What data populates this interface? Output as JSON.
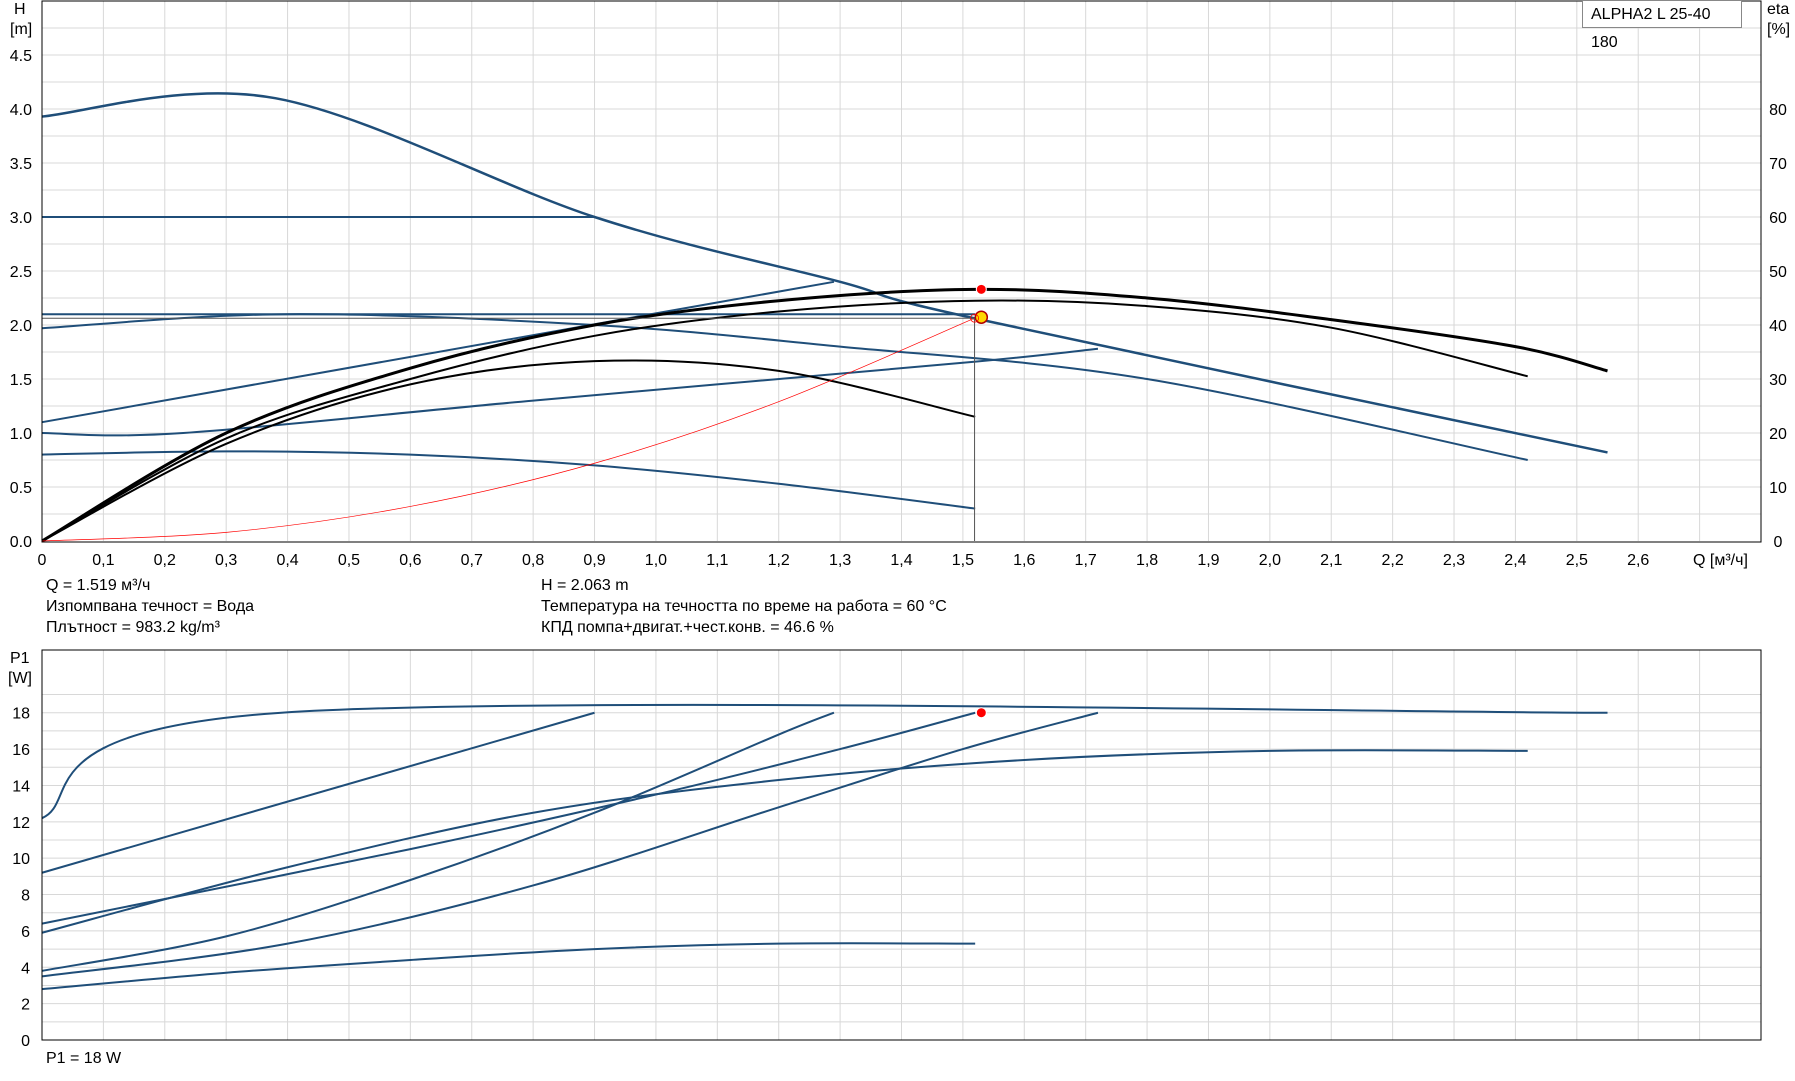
{
  "top_chart": {
    "y_left_label_line1": "H",
    "y_left_label_line2": "[m]",
    "y_right_label_line1": "eta",
    "y_right_label_line2": "[%]",
    "x_label": "Q [м³/ч]",
    "x_ticks": [
      "0",
      "0,1",
      "0,2",
      "0,3",
      "0,4",
      "0,5",
      "0,6",
      "0,7",
      "0,8",
      "0,9",
      "1,0",
      "1,1",
      "1,2",
      "1,3",
      "1,4",
      "1,5",
      "1,6",
      "1,7",
      "1,8",
      "1,9",
      "2,0",
      "2,1",
      "2,2",
      "2,3",
      "2,4",
      "2,5",
      "2,6"
    ],
    "y_left_ticks": [
      "0.0",
      "0.5",
      "1.0",
      "1.5",
      "2.0",
      "2.5",
      "3.0",
      "3.5",
      "4.0",
      "4.5"
    ],
    "y_right_ticks": [
      "0",
      "10",
      "20",
      "30",
      "40",
      "50",
      "60",
      "70",
      "80"
    ],
    "model_label": "ALPHA2 L 25-40 180"
  },
  "info": {
    "q": "Q = 1.519 м³/ч",
    "fluid": "Изпомпвана течност = Вода",
    "density": "Плътност = 983.2 kg/m³",
    "h": "H = 2.063 m",
    "temp": "Температура на течността по време на работа = 60 °C",
    "eff": "КПД помпа+двигат.+чест.конв. = 46.6 %",
    "p1": "P1 = 18 W"
  },
  "bottom_chart": {
    "y_label_line1": "P1",
    "y_label_line2": "[W]",
    "y_ticks": [
      "0",
      "2",
      "4",
      "6",
      "8",
      "10",
      "12",
      "14",
      "16",
      "18"
    ]
  },
  "colors": {
    "blue": "#1f4e79",
    "black": "#000000",
    "red": "#ff0000",
    "yellow": "#ffd700",
    "grid": "#d8d8d8"
  },
  "chart_data": [
    {
      "type": "line",
      "title": "",
      "xlabel": "Q [м³/ч]",
      "ylabel": "H [m]",
      "y2label": "eta [%]",
      "xlim": [
        0,
        2.8
      ],
      "ylim": [
        0,
        5.0
      ],
      "y2lim": [
        0,
        100
      ],
      "grid": true,
      "series": [
        {
          "axis": "H",
          "style": "blue",
          "x": [
            0,
            0.38,
            0.9,
            1.3,
            1.52,
            2.55
          ],
          "y": [
            3.93,
            4.1,
            3.0,
            2.4,
            2.06,
            0.82
          ]
        },
        {
          "axis": "H",
          "style": "blue",
          "x": [
            0,
            0.9
          ],
          "y": [
            3.0,
            3.0
          ]
        },
        {
          "axis": "H",
          "style": "blue",
          "x": [
            0,
            1.52
          ],
          "y": [
            2.1,
            2.1
          ]
        },
        {
          "axis": "H",
          "style": "blue",
          "x": [
            0,
            1.29
          ],
          "y": [
            1.1,
            2.4
          ]
        },
        {
          "axis": "H",
          "style": "blue",
          "x": [
            0,
            0.4,
            0.9,
            1.3,
            1.8,
            2.42
          ],
          "y": [
            1.97,
            2.1,
            2.0,
            1.8,
            1.5,
            0.75
          ]
        },
        {
          "axis": "H",
          "style": "blue",
          "x": [
            0,
            0.23,
            0.8,
            1.5,
            1.72
          ],
          "y": [
            1.0,
            1.0,
            1.3,
            1.65,
            1.78
          ]
        },
        {
          "axis": "H",
          "style": "blue",
          "x": [
            0,
            0.3,
            0.6,
            0.9,
            1.2,
            1.52
          ],
          "y": [
            0.8,
            0.83,
            0.8,
            0.7,
            0.53,
            0.3
          ]
        },
        {
          "axis": "eta",
          "style": "black",
          "x": [
            0,
            0.3,
            0.6,
            0.9,
            1.2,
            1.52,
            1.8,
            2.1,
            2.4,
            2.55
          ],
          "y": [
            0,
            20,
            32,
            40,
            44.5,
            46.6,
            45,
            41,
            36,
            31.5
          ]
        },
        {
          "axis": "eta",
          "style": "black",
          "x": [
            0,
            0.3,
            0.6,
            0.9,
            1.2,
            1.52,
            1.8,
            2.1,
            2.42
          ],
          "y": [
            0,
            19,
            30,
            38,
            42.5,
            44.5,
            43.5,
            39.5,
            30.5
          ]
        },
        {
          "axis": "eta",
          "style": "black",
          "x": [
            0,
            0.3,
            0.6,
            0.9,
            1.2,
            1.52
          ],
          "y": [
            0,
            18,
            29,
            33.3,
            31.5,
            23
          ]
        },
        {
          "axis": "H",
          "style": "system",
          "x": [
            0,
            0.3,
            0.6,
            0.9,
            1.2,
            1.519
          ],
          "y": [
            0,
            0.08,
            0.32,
            0.72,
            1.29,
            2.063
          ]
        }
      ],
      "points": [
        {
          "name": "duty",
          "x": 1.519,
          "y": 2.063,
          "color": "yellow"
        },
        {
          "name": "eta-max",
          "x": 1.519,
          "y2": 46.6,
          "color": "red"
        }
      ]
    },
    {
      "type": "line",
      "title": "",
      "xlabel": "Q [м³/ч]",
      "ylabel": "P1 [W]",
      "xlim": [
        0,
        2.8
      ],
      "ylim": [
        0,
        22
      ],
      "grid": true,
      "series": [
        {
          "style": "blue",
          "x": [
            0,
            0.39,
            2.55
          ],
          "y": [
            12.2,
            18,
            18
          ]
        },
        {
          "style": "blue",
          "x": [
            0,
            0.9
          ],
          "y": [
            9.2,
            18
          ]
        },
        {
          "style": "blue",
          "x": [
            0,
            0.6,
            1.0,
            1.3,
            1.52
          ],
          "y": [
            6.4,
            10.5,
            13.5,
            16,
            18
          ]
        },
        {
          "style": "blue",
          "x": [
            0,
            0.3,
            0.6,
            0.9,
            1.2,
            1.29
          ],
          "y": [
            3.8,
            5.7,
            8.8,
            12.5,
            16.8,
            18
          ]
        },
        {
          "style": "blue",
          "x": [
            0,
            0.4,
            0.8,
            1.2,
            1.6,
            2.0,
            2.42
          ],
          "y": [
            5.9,
            9.5,
            12.5,
            14.3,
            15.4,
            15.9,
            15.9
          ]
        },
        {
          "style": "blue",
          "x": [
            0,
            0.4,
            0.8,
            1.2,
            1.5,
            1.72
          ],
          "y": [
            3.5,
            5.3,
            8.5,
            12.8,
            16,
            18
          ]
        },
        {
          "style": "blue",
          "x": [
            0,
            0.3,
            0.6,
            0.9,
            1.2,
            1.52
          ],
          "y": [
            2.8,
            3.7,
            4.4,
            5.0,
            5.3,
            5.3
          ]
        }
      ],
      "points": [
        {
          "name": "duty-p1",
          "x": 1.519,
          "y": 18,
          "color": "red"
        }
      ]
    }
  ]
}
